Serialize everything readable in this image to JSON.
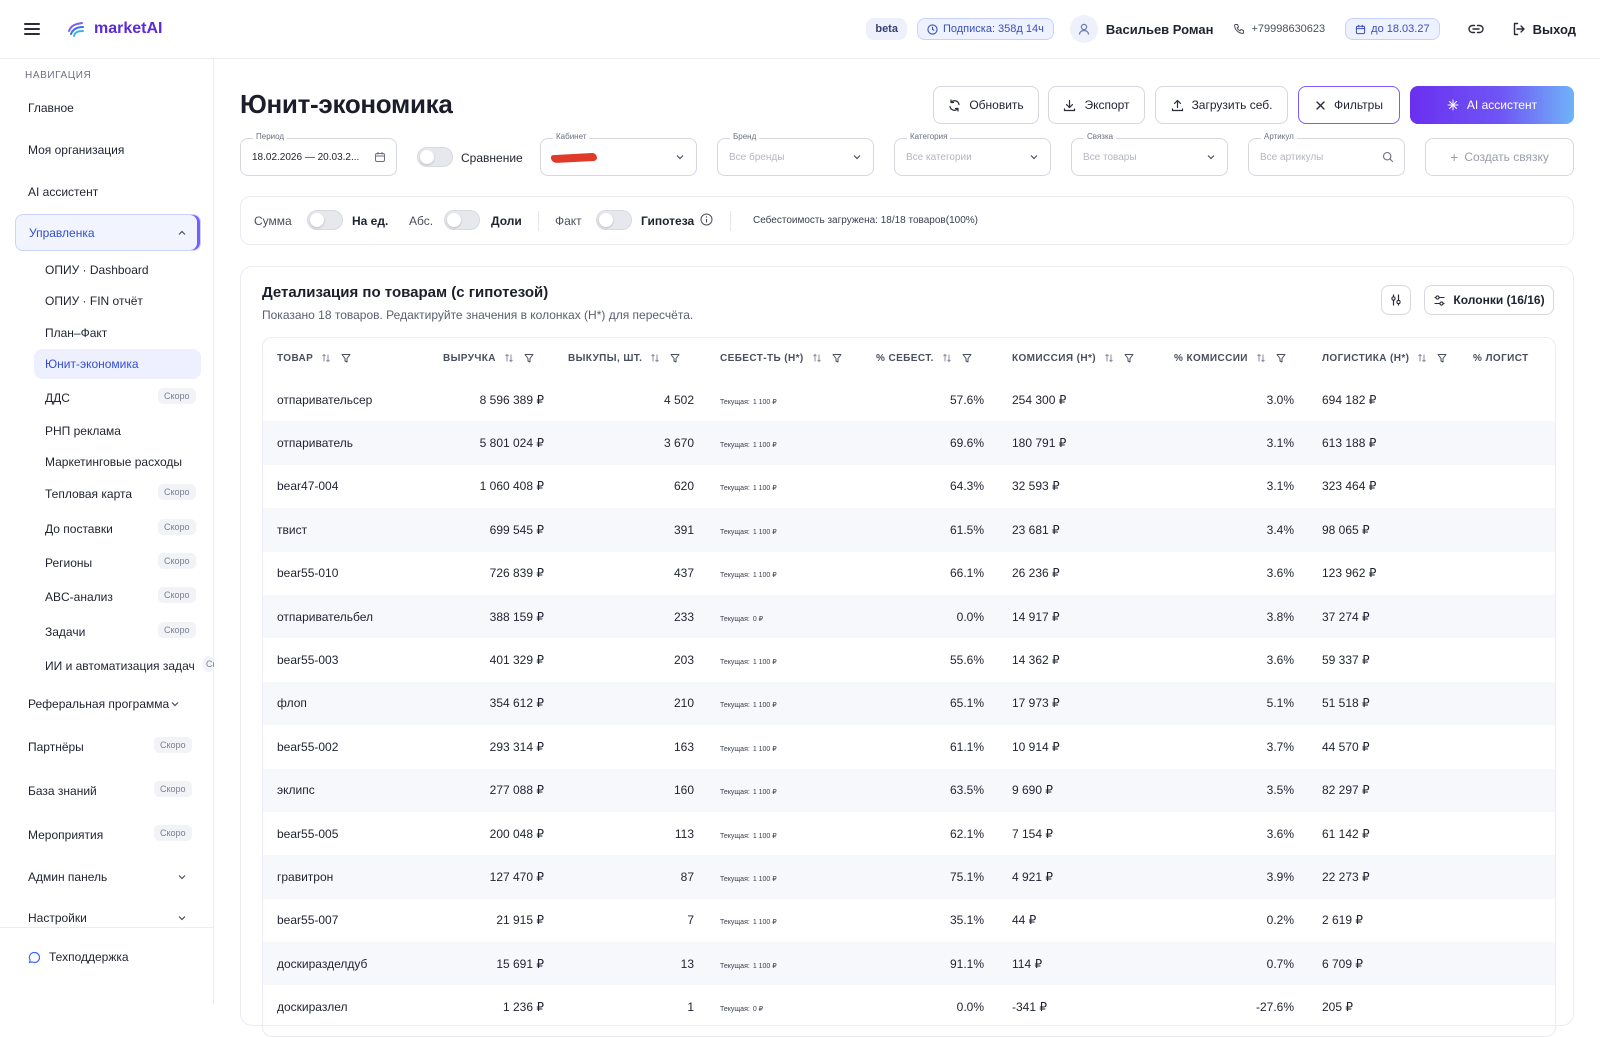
{
  "brand": {
    "name": "marketAI",
    "accent": "#5b2bd6"
  },
  "topbar": {
    "beta": "beta",
    "subscription": "Подписка: 358д 14ч",
    "user_name": "Васильев Роман",
    "phone": "+79998630623",
    "until": "до 18.03.27",
    "logout": "Выход"
  },
  "sidebar": {
    "title": "НАВИГАЦИЯ",
    "items": [
      "Главное",
      "Моя организация",
      "AI ассистент"
    ],
    "group": "Управленка",
    "sub": [
      {
        "label": "ОПИУ · Dashboard"
      },
      {
        "label": "ОПИУ · FIN отчёт"
      },
      {
        "label": "План–Факт"
      },
      {
        "label": "Юнит-экономика",
        "active": true
      },
      {
        "label": "ДДС",
        "soon": "Скоро"
      },
      {
        "label": "РНП реклама"
      },
      {
        "label": "Маркетинговые расходы"
      },
      {
        "label": "Тепловая карта",
        "soon": "Скоро"
      },
      {
        "label": "До поставки",
        "soon": "Скоро"
      },
      {
        "label": "Регионы",
        "soon": "Скоро"
      },
      {
        "label": "ABC-анализ",
        "soon": "Скоро"
      },
      {
        "label": "Задачи",
        "soon": "Скоро"
      },
      {
        "label": "ИИ и автоматизация задач",
        "soon": "Ск"
      }
    ],
    "bottom": [
      {
        "label": "Реферальная программа"
      },
      {
        "label": "Партнёры",
        "soon": "Скоро"
      },
      {
        "label": "База знаний",
        "soon": "Скоро"
      },
      {
        "label": "Мероприятия",
        "soon": "Скоро"
      },
      {
        "label": "Админ панель"
      },
      {
        "label": "Настройки"
      }
    ],
    "support": "Техподдержка"
  },
  "page": {
    "title": "Юнит-экономика",
    "buttons": {
      "refresh": "Обновить",
      "export": "Экспорт",
      "upload": "Загрузить себ.",
      "filters": "Фильтры",
      "ai": "AI ассистент"
    },
    "fields": {
      "period_label": "Период",
      "period_value": "18.02.2026 — 20.03.2...",
      "compare": "Сравнение",
      "cabinet_label": "Кабинет",
      "brand_label": "Бренд",
      "brand_ph": "Все бренды",
      "category_label": "Категория",
      "category_ph": "Все категории",
      "link_label": "Связка",
      "link_ph": "Все товары",
      "article_label": "Артикул",
      "article_ph": "Все артикулы",
      "create_link": "Создать связку"
    },
    "options": {
      "sum": "Сумма",
      "per_unit": "На ед.",
      "abs": "Абс.",
      "shares": "Доли",
      "fact": "Факт",
      "hypothesis": "Гипотеза",
      "cost_status": "Себестоимость загружена: 18/18 товаров(100%)"
    },
    "card": {
      "title": "Детализация по товарам (с гипотезой)",
      "subtitle": "Показано 18 товаров. Редактируйте значения в колонках (Н*) для пересчёта.",
      "columns_btn": "Колонки (16/16)"
    }
  },
  "table": {
    "headers": [
      "ТОВАР",
      "ВЫРУЧКА",
      "ВЫКУПЫ, ШТ.",
      "СЕБЕСТ-ТЬ (Н*)",
      "% СЕБЕСТ.",
      "КОМИССИЯ (Н*)",
      "% КОМИССИИ",
      "ЛОГИСТИКА (Н*)",
      "% ЛОГИСТ"
    ],
    "current_label": "Текущая:",
    "rows": [
      [
        "отпаривательсер",
        "8 596 389 ₽",
        "4 502",
        "1 100 ₽",
        "57.6%",
        "254 300 ₽",
        "3.0%",
        "694 182 ₽"
      ],
      [
        "отпариватель",
        "5 801 024 ₽",
        "3 670",
        "1 100 ₽",
        "69.6%",
        "180 791 ₽",
        "3.1%",
        "613 188 ₽"
      ],
      [
        "bear47-004",
        "1 060 408 ₽",
        "620",
        "1 100 ₽",
        "64.3%",
        "32 593 ₽",
        "3.1%",
        "323 464 ₽"
      ],
      [
        "твист",
        "699 545 ₽",
        "391",
        "1 100 ₽",
        "61.5%",
        "23 681 ₽",
        "3.4%",
        "98 065 ₽"
      ],
      [
        "bear55-010",
        "726 839 ₽",
        "437",
        "1 100 ₽",
        "66.1%",
        "26 236 ₽",
        "3.6%",
        "123 962 ₽"
      ],
      [
        "отпаривательбел",
        "388 159 ₽",
        "233",
        "0 ₽",
        "0.0%",
        "14 917 ₽",
        "3.8%",
        "37 274 ₽"
      ],
      [
        "bear55-003",
        "401 329 ₽",
        "203",
        "1 100 ₽",
        "55.6%",
        "14 362 ₽",
        "3.6%",
        "59 337 ₽"
      ],
      [
        "флоп",
        "354 612 ₽",
        "210",
        "1 100 ₽",
        "65.1%",
        "17 973 ₽",
        "5.1%",
        "51 518 ₽"
      ],
      [
        "bear55-002",
        "293 314 ₽",
        "163",
        "1 100 ₽",
        "61.1%",
        "10 914 ₽",
        "3.7%",
        "44 570 ₽"
      ],
      [
        "эклипс",
        "277 088 ₽",
        "160",
        "1 100 ₽",
        "63.5%",
        "9 690 ₽",
        "3.5%",
        "82 297 ₽"
      ],
      [
        "bear55-005",
        "200 048 ₽",
        "113",
        "1 100 ₽",
        "62.1%",
        "7 154 ₽",
        "3.6%",
        "61 142 ₽"
      ],
      [
        "гравитрон",
        "127 470 ₽",
        "87",
        "1 100 ₽",
        "75.1%",
        "4 921 ₽",
        "3.9%",
        "22 273 ₽"
      ],
      [
        "bear55-007",
        "21 915 ₽",
        "7",
        "1 100 ₽",
        "35.1%",
        "44 ₽",
        "0.2%",
        "2 619 ₽"
      ],
      [
        "доскиразделдуб",
        "15 691 ₽",
        "13",
        "1 100 ₽",
        "91.1%",
        "114 ₽",
        "0.7%",
        "6 709 ₽"
      ],
      [
        "доскиразлел",
        "1 236 ₽",
        "1",
        "0 ₽",
        "0.0%",
        "-341 ₽",
        "-27.6%",
        "205 ₽"
      ]
    ]
  }
}
